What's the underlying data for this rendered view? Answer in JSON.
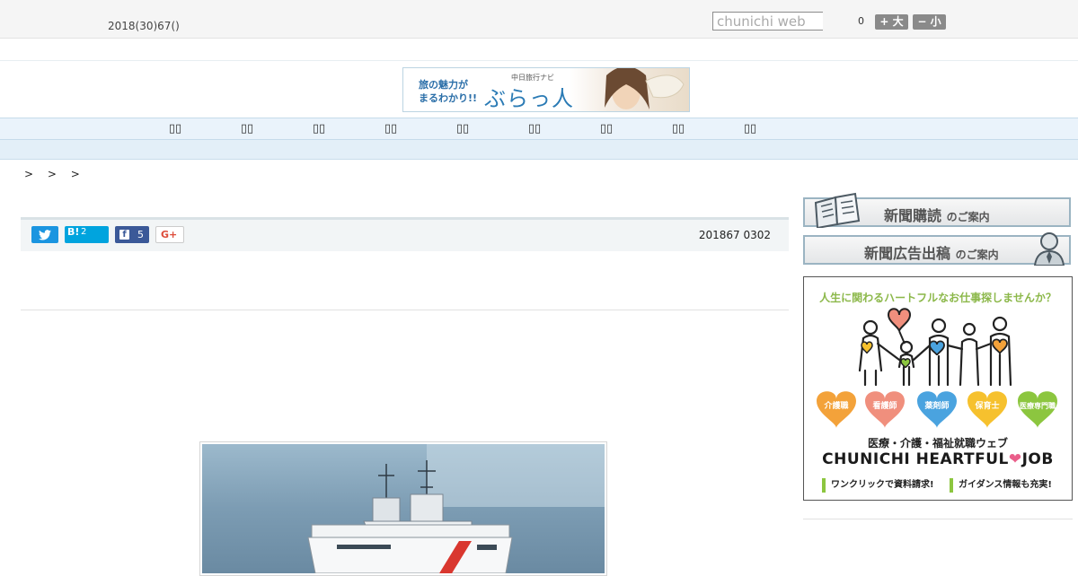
{
  "header": {
    "date": "2018(30)67()",
    "search": {
      "placeholder": "chunichi web"
    },
    "font_size": {
      "value": "0",
      "increase_label": "+ 大",
      "decrease_label": "− 小"
    }
  },
  "banner": {
    "tagline_line1": "旅の魅力が",
    "tagline_line2": "まるわかり!!",
    "subtitle": "中日旅行ナビ",
    "brand": "ぶらっ人"
  },
  "nav": {
    "items": [
      "",
      "",
      "",
      "",
      "",
      "",
      "",
      "",
      ""
    ]
  },
  "breadcrumb": {
    "text": "> > >"
  },
  "share": {
    "hatena_label": "B!",
    "hatena_count": "2",
    "facebook_count": "5",
    "gplus_label": "G+"
  },
  "article": {
    "published": "201867 0302"
  },
  "sidebar": {
    "subscribe": {
      "title": "新聞購読",
      "suffix": "のご案内"
    },
    "advertise": {
      "title": "新聞広告出稿",
      "suffix": "のご案内"
    },
    "ad": {
      "headline": "人生に関わるハートフルなお仕事探しませんか？",
      "jobs": [
        "介護職",
        "看護師",
        "薬剤師",
        "保育士",
        "医療専門職"
      ],
      "tagline": "医療・介護・福祉就職ウェブ",
      "brand_left": "CHUNICHI HEARTFUL",
      "brand_heart": "❤",
      "brand_right": "JOB",
      "cta1": "ワンクリックで資料請求!",
      "cta2": "ガイダンス情報も充実!"
    }
  },
  "colors": {
    "twitter": "#1b95e0",
    "hatena": "#00a4de",
    "facebook": "#3b5998",
    "nav_bg": "#eaf3fb",
    "ad_green": "#8cb84a",
    "heart_orange": "#f3a23a",
    "heart_salmon": "#f08f7d",
    "heart_blue": "#4aa3df",
    "heart_yellow": "#f6c12e",
    "heart_green": "#8cc63f"
  }
}
